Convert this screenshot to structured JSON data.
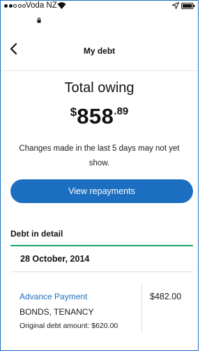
{
  "status_bar": {
    "signal_bars": 5,
    "signal_filled": 2,
    "carrier": "Voda NZ"
  },
  "nav": {
    "title": "My debt"
  },
  "summary": {
    "label": "Total owing",
    "currency_symbol": "$",
    "amount_whole": "858",
    "amount_cents": ".89",
    "notice": "Changes made in the last 5 days may not yet show.",
    "button_label": "View repayments"
  },
  "detail": {
    "section_title": "Debt in detail",
    "date": "28 October, 2014",
    "item": {
      "title": "Advance Payment",
      "subtitle": "BONDS, TENANCY",
      "original": "Original debt amount: $620.00",
      "amount": "$482.00"
    }
  },
  "colors": {
    "accent_blue": "#1c6fc0",
    "green_rule": "#19a36a",
    "divider": "#e0e0e0"
  }
}
